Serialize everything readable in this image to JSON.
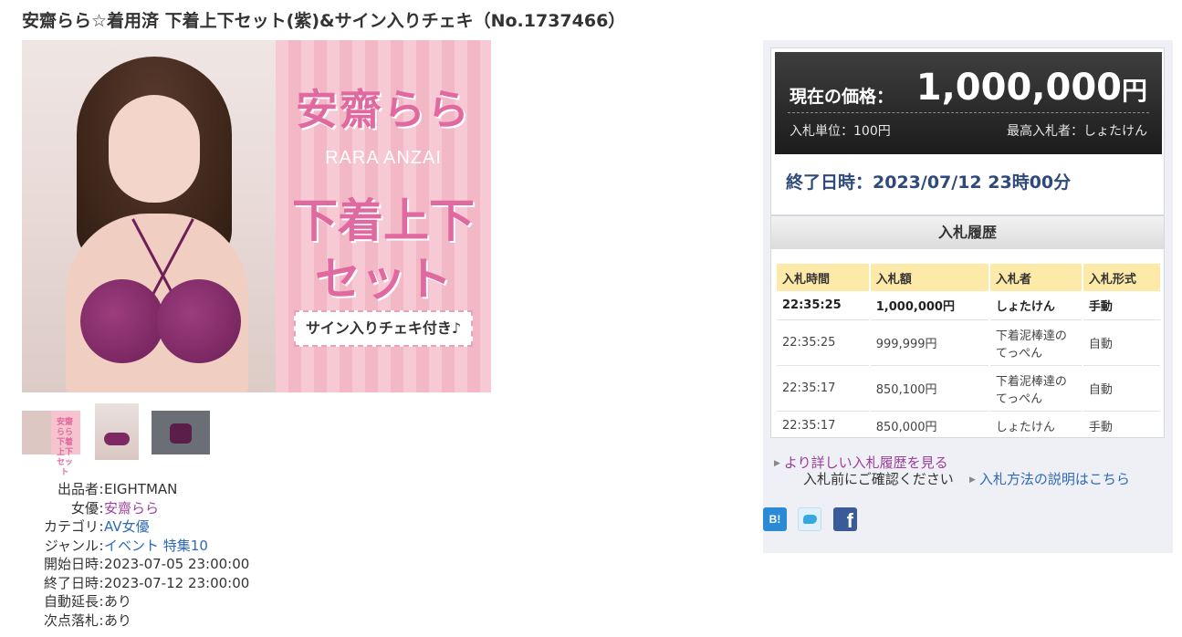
{
  "title": "安齋らら☆着用済 下着上下セット(紫)&サイン入りチェキ（No.1737466）",
  "banner": {
    "name_ja": "安齋らら",
    "name_en": "RARA ANZAI",
    "line1": "下着上下",
    "line2": "セット",
    "tag": "サイン入りチェキ付き♪"
  },
  "thumbnails": [
    {
      "label": "安齋らら 下着上下 セット"
    },
    {
      "label": ""
    },
    {
      "label": ""
    }
  ],
  "details": [
    {
      "key": "出品者",
      "value": "EIGHTMAN"
    },
    {
      "key": "女優",
      "value": "安齋らら"
    },
    {
      "key": "カテゴリ",
      "value": "AV女優"
    },
    {
      "key": "ジャンル",
      "value_a": "イベント",
      "value_b": "特集10"
    },
    {
      "key": "開始日時",
      "value": "2023-07-05 23:00:00"
    },
    {
      "key": "終了日時",
      "value": "2023-07-12 23:00:00"
    },
    {
      "key": "自動延長",
      "value": "あり"
    },
    {
      "key": "次点落札",
      "value": "あり"
    }
  ],
  "auction": {
    "price_label": "現在の価格：",
    "price_value": "1,000,000",
    "price_unit": "円",
    "bid_unit": "入札単位：100円",
    "top_bidder": "最高入札者：しょたけん",
    "end_time": "終了日時：2023/07/12 23時00分"
  },
  "history": {
    "heading": "入札履歴",
    "columns": [
      "入札時間",
      "入札額",
      "入札者",
      "入札形式"
    ],
    "rows": [
      {
        "time": "22:35:25",
        "amount": "1,000,000円",
        "bidder": "しょたけん",
        "type": "手動"
      },
      {
        "time": "22:35:25",
        "amount": "999,999円",
        "bidder": "下着泥棒達のてっぺん",
        "type": "自動"
      },
      {
        "time": "22:35:17",
        "amount": "850,100円",
        "bidder": "下着泥棒達のてっぺん",
        "type": "自動"
      },
      {
        "time": "22:35:17",
        "amount": "850,000円",
        "bidder": "しょたけん",
        "type": "手動"
      }
    ]
  },
  "links": {
    "more_history": "より詳しい入札履歴を見る",
    "confirm": "入札前にご確認ください",
    "method": "入札方法の説明はこちら"
  },
  "share": {
    "hatena": "B!",
    "twitter": "twitter-icon",
    "facebook": "f"
  },
  "colors": {
    "price_bg": "#1c1c1c",
    "table_header": "#fde9a8",
    "panel_bg": "#eef0f5",
    "link_purple": "#9b3f9b",
    "link_blue": "#2f6ab5",
    "banner_pink": "#e06aa0"
  }
}
